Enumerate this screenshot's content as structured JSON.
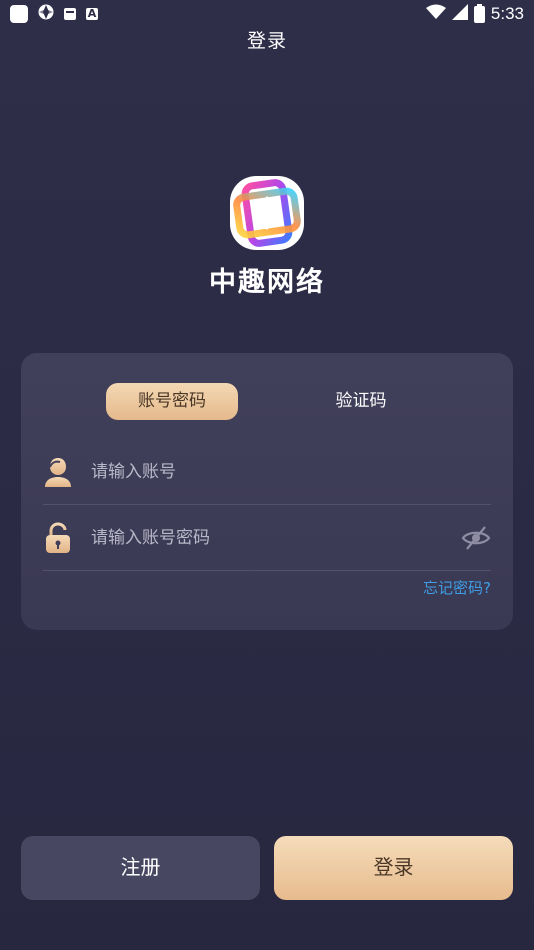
{
  "status_bar": {
    "time": "5:33",
    "left_icons": [
      "app-square-icon",
      "aperture-icon",
      "message-icon",
      "a-icon"
    ],
    "a_icon_text": "A",
    "right_icons": [
      "wifi-icon",
      "signal-icon",
      "battery-icon"
    ]
  },
  "header": {
    "title": "登录"
  },
  "brand": {
    "name": "中趣网络",
    "logo_icon": "brand-logo-icon"
  },
  "login_card": {
    "tabs": [
      {
        "label": "账号密码",
        "active": true
      },
      {
        "label": "验证码",
        "active": false
      }
    ],
    "account_field": {
      "placeholder": "请输入账号",
      "value": "",
      "icon": "user-icon"
    },
    "password_field": {
      "placeholder": "请输入账号密码",
      "value": "",
      "icon": "lock-icon",
      "toggle_icon": "eye-hidden-icon"
    },
    "forgot_label": "忘记密码?"
  },
  "actions": {
    "register_label": "注册",
    "login_label": "登录"
  },
  "colors": {
    "background": "#2b2a44",
    "card": "#3d3c56",
    "accent_gold": "#eac69c",
    "link_blue": "#3f9de6",
    "button_dark": "#484762"
  }
}
